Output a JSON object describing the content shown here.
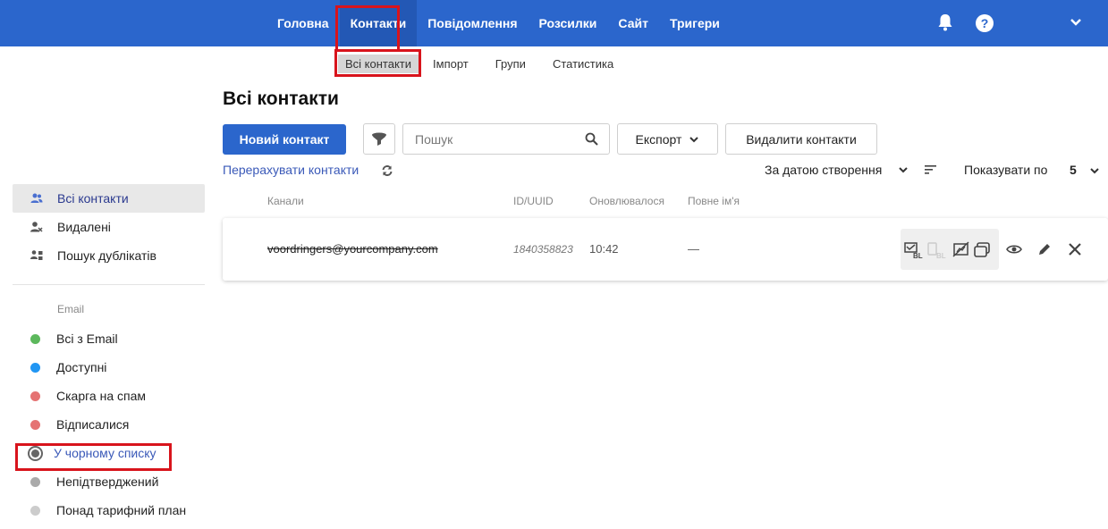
{
  "topnav": {
    "items": [
      {
        "label": "Головна"
      },
      {
        "label": "Контакти"
      },
      {
        "label": "Повідомлення"
      },
      {
        "label": "Розсилки"
      },
      {
        "label": "Сайт"
      },
      {
        "label": "Тригери"
      }
    ],
    "active_index": 1,
    "icons": [
      "bell-icon",
      "help-icon",
      "chevron-down-icon"
    ],
    "help_label": "?"
  },
  "subnav": {
    "items": [
      {
        "label": "Всі контакти"
      },
      {
        "label": "Імпорт"
      },
      {
        "label": "Групи"
      },
      {
        "label": "Статистика"
      }
    ],
    "active_index": 0
  },
  "sidebar": {
    "items": [
      {
        "label": "Всі контакти",
        "icon": "users-icon"
      },
      {
        "label": "Видалені",
        "icon": "user-remove-icon"
      },
      {
        "label": "Пошук дублікатів",
        "icon": "duplicates-icon"
      }
    ],
    "email_heading": "Email",
    "email_items": [
      {
        "label": "Всі з Email",
        "color": "#5cb85c"
      },
      {
        "label": "Доступні",
        "color": "#2196f3"
      },
      {
        "label": "Скарга на спам",
        "color": "#e57373"
      },
      {
        "label": "Відписалися",
        "color": "#e57373"
      },
      {
        "label": "У чорному списку",
        "color": "#666666"
      },
      {
        "label": "Непідтверджений",
        "color": "#aaaaaa"
      },
      {
        "label": "Понад тарифний план",
        "color": "#cccccc"
      }
    ]
  },
  "main": {
    "title": "Всі контакти",
    "new_contact_label": "Новий контакт",
    "search_placeholder": "Пошук",
    "export_label": "Експорт",
    "delete_label": "Видалити контакти",
    "recount_label": "Перерахувати контакти",
    "sort_label": "За датою створення",
    "show_label": "Показувати по",
    "show_value": "5",
    "columns": {
      "channels": "Канали",
      "id": "ID/UUID",
      "updated": "Оновлювалося",
      "fullname": "Повне ім'я"
    },
    "rows": [
      {
        "email": "voordringers@yourcompany.com",
        "id": "1840358823",
        "updated": "10:42",
        "fullname": "—"
      }
    ]
  },
  "colors": {
    "brand": "#2b66cc",
    "highlight": "#d8141c"
  }
}
